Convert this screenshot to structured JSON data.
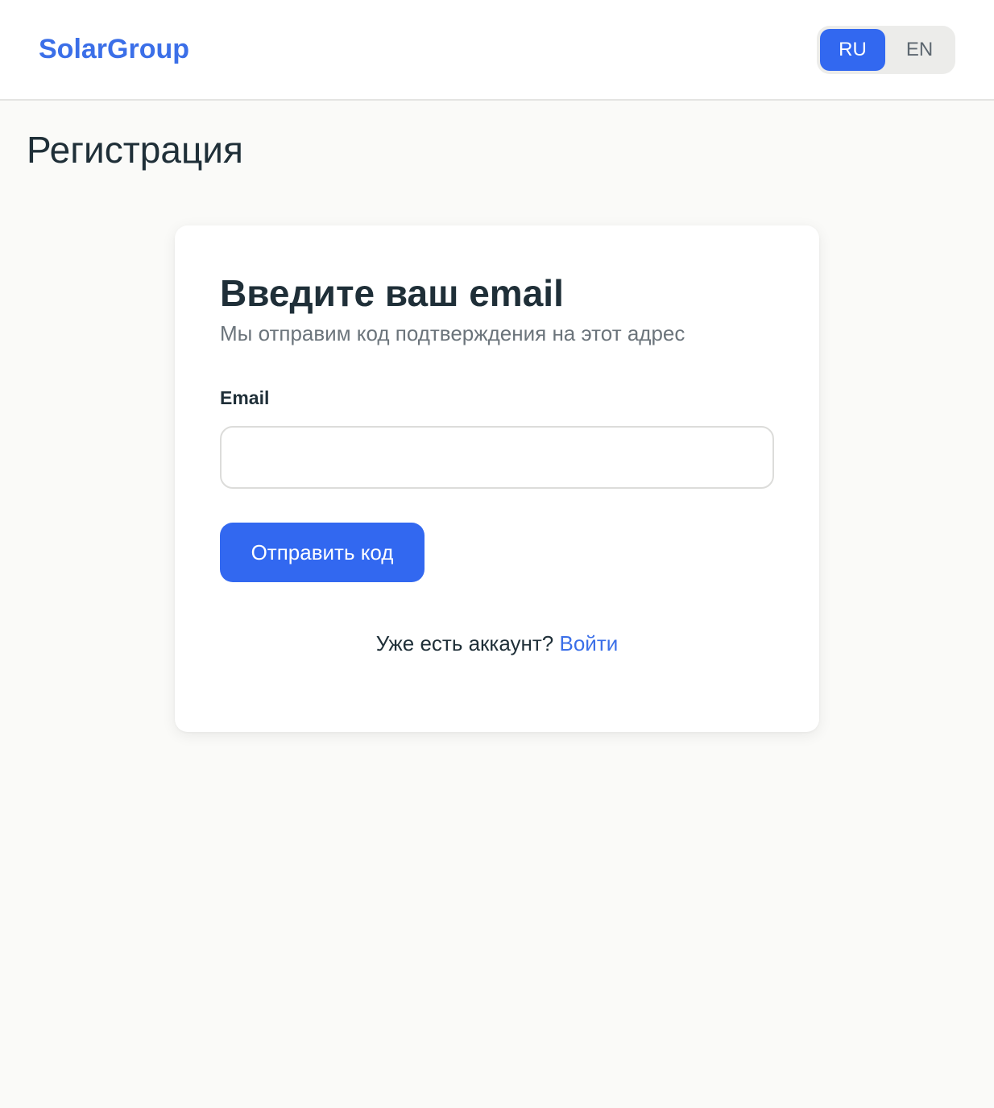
{
  "header": {
    "logo": "SolarGroup",
    "languages": [
      {
        "label": "RU",
        "active": true
      },
      {
        "label": "EN",
        "active": false
      }
    ]
  },
  "page": {
    "title": "Регистрация"
  },
  "card": {
    "title": "Введите ваш email",
    "subtitle": "Мы отправим код подтверждения на этот адрес",
    "email_label": "Email",
    "email_value": "",
    "email_placeholder": "",
    "submit_label": "Отправить код",
    "login_prompt": "Уже есть аккаунт?",
    "login_link": "Войти"
  },
  "colors": {
    "accent": "#3268f0",
    "logo": "#3b6fe8",
    "background": "#fafaf8",
    "text": "#1f2f38",
    "muted": "#6b747b"
  }
}
